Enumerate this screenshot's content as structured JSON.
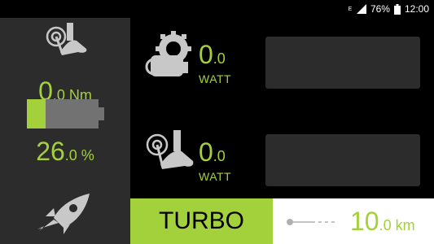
{
  "status_bar": {
    "network_type": "E",
    "battery_percent": "76%",
    "time": "12:00",
    "icons": [
      "signal-icon",
      "battery-icon"
    ]
  },
  "torque": {
    "value_main": "0",
    "value_decimal": ".0",
    "unit": "Nm"
  },
  "battery": {
    "value_main": "26",
    "value_decimal": ".0",
    "unit": "%",
    "level_percent": 26
  },
  "rider_power": {
    "value_main": "0",
    "value_decimal": ".0",
    "unit": "WATT"
  },
  "motor_power": {
    "value_main": "0",
    "value_decimal": ".0",
    "unit": "WATT"
  },
  "assist_mode": {
    "label": "TURBO"
  },
  "distance": {
    "value_main": "10",
    "value_decimal": ".0",
    "unit": "km"
  },
  "colors": {
    "accent": "#a3d13c",
    "panel": "#2c2c2c",
    "icon_gray": "#c8c8c8",
    "background": "#000000"
  }
}
